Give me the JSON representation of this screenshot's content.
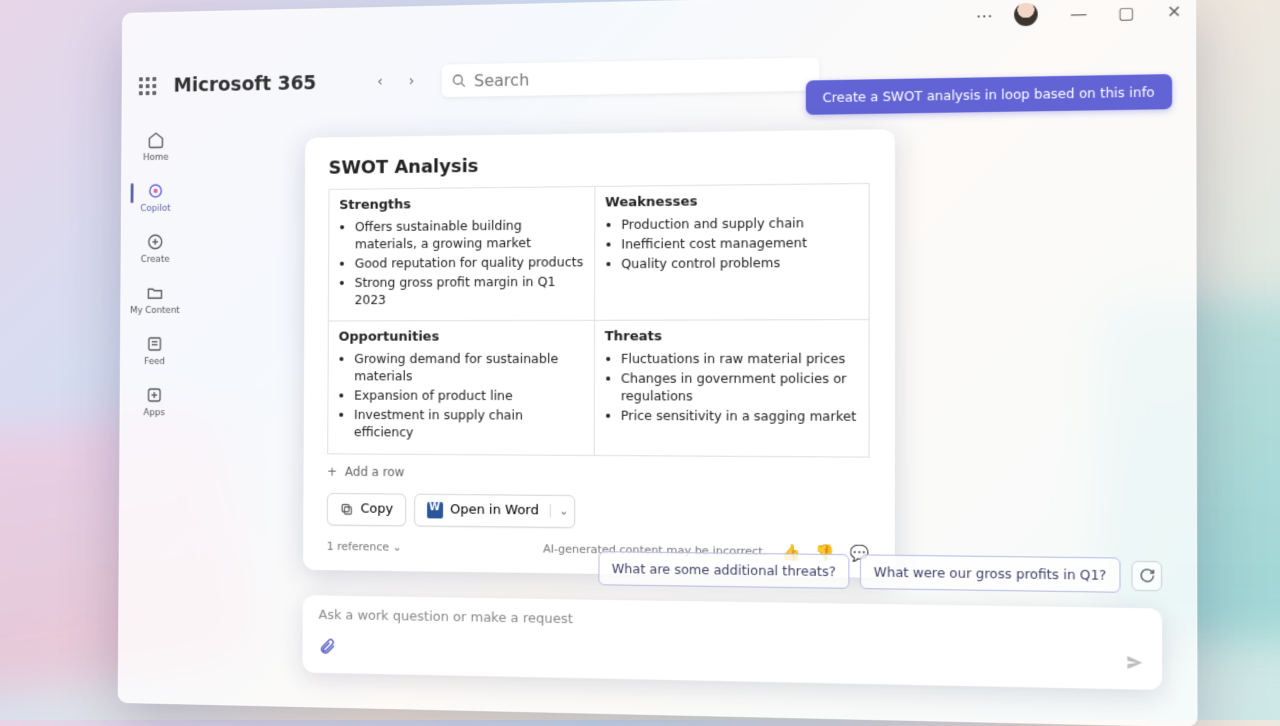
{
  "header": {
    "brand": "Microsoft 365",
    "search_placeholder": "Search"
  },
  "window_controls": {
    "more": "⋯"
  },
  "sidebar": {
    "items": [
      {
        "label": "Home"
      },
      {
        "label": "Copilot"
      },
      {
        "label": "Create"
      },
      {
        "label": "My Content"
      },
      {
        "label": "Feed"
      },
      {
        "label": "Apps"
      }
    ]
  },
  "prompt": "Create a SWOT analysis in loop based on this info",
  "card": {
    "title": "SWOT Analysis",
    "quadrants": {
      "strengths": {
        "heading": "Strengths",
        "items": [
          "Offers sustainable building materials, a growing market",
          "Good reputation for quality products",
          "Strong gross profit margin in Q1 2023"
        ]
      },
      "weaknesses": {
        "heading": "Weaknesses",
        "items": [
          "Production and supply chain",
          "Inefficient cost management",
          "Quality control problems"
        ]
      },
      "opportunities": {
        "heading": "Opportunities",
        "items": [
          "Growing demand for sustainable materials",
          "Expansion of product line",
          "Investment in supply chain efficiency"
        ]
      },
      "threats": {
        "heading": "Threats",
        "items": [
          "Fluctuations in raw material prices",
          "Changes in government policies or regulations",
          "Price sensitivity in a sagging market"
        ]
      }
    },
    "add_row": "Add a row",
    "copy_label": "Copy",
    "open_word_label": "Open in Word",
    "disclaimer": "AI-generated content may be incorrect.",
    "reference": "1 reference"
  },
  "suggestions": [
    "What are some additional threats?",
    "What were our gross profits in Q1?"
  ],
  "composer": {
    "placeholder": "Ask a work question or make a request"
  }
}
